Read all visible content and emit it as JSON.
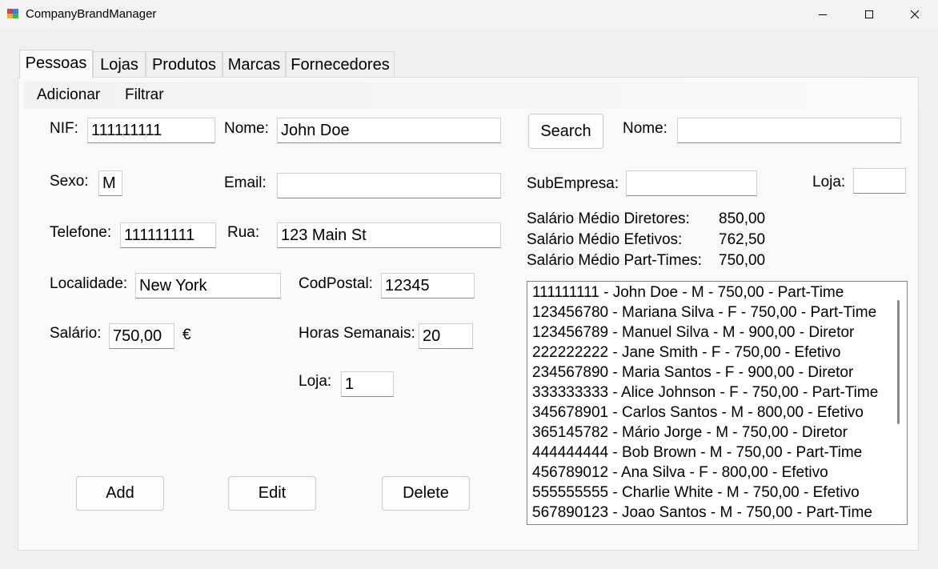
{
  "window": {
    "title": "CompanyBrandManager"
  },
  "tabs": [
    "Pessoas",
    "Lojas",
    "Produtos",
    "Marcas",
    "Fornecedores"
  ],
  "menu": [
    "Adicionar",
    "Filtrar"
  ],
  "form": {
    "nif_label": "NIF:",
    "nif_value": "111111111",
    "nome_label": "Nome:",
    "nome_value": "John Doe",
    "sexo_label": "Sexo:",
    "sexo_value": "M",
    "email_label": "Email:",
    "email_value": "",
    "telefone_label": "Telefone:",
    "telefone_value": "111111111",
    "rua_label": "Rua:",
    "rua_value": "123 Main St",
    "localidade_label": "Localidade:",
    "localidade_value": "New York",
    "codpostal_label": "CodPostal:",
    "codpostal_value": "12345",
    "salario_label": "Salário:",
    "salario_value": "750,00",
    "currency": "€",
    "horas_label": "Horas Semanais:",
    "horas_value": "20",
    "loja_label": "Loja:",
    "loja_value": "1"
  },
  "actions": {
    "add": "Add",
    "edit": "Edit",
    "delete": "Delete"
  },
  "search": {
    "button": "Search",
    "nome_label": "Nome:",
    "nome_value": "",
    "subempresa_label": "SubEmpresa:",
    "subempresa_value": "",
    "loja_label": "Loja:",
    "loja_value": ""
  },
  "stats": [
    {
      "label": "Salário Médio Diretores:",
      "value": "850,00"
    },
    {
      "label": "Salário Médio Efetivos:",
      "value": "762,50"
    },
    {
      "label": "Salário Médio Part-Times:",
      "value": "750,00"
    }
  ],
  "list_items": [
    "111111111 - John Doe - M - 750,00 - Part-Time",
    "123456780 - Mariana Silva - F - 750,00 - Part-Time",
    "123456789 - Manuel Silva - M - 900,00 - Diretor",
    "222222222 - Jane Smith - F - 750,00 - Efetivo",
    "234567890 - Maria Santos - F - 900,00 - Diretor",
    "333333333 - Alice Johnson - F - 750,00 - Part-Time",
    "345678901 - Carlos Santos - M - 800,00 - Efetivo",
    "365145782 - Mário Jorge - M - 750,00 - Diretor",
    "444444444 - Bob Brown - M - 750,00 - Part-Time",
    "456789012 - Ana Silva - F - 800,00 - Efetivo",
    "555555555 - Charlie White - M - 750,00 - Efetivo",
    "567890123 - Joao Santos - M - 750,00 - Part-Time"
  ]
}
